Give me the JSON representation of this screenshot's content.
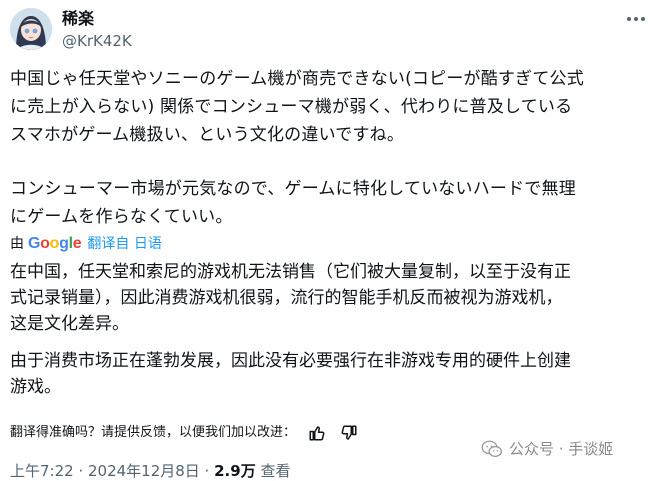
{
  "author": {
    "display_name": "稀楽",
    "handle": "@KrK42K"
  },
  "post": {
    "lines_p1": [
      "中国じゃ任天堂やソニーのゲーム機が商売できない(コピーが酷すぎて公式",
      "に売上が入らない) 関係でコンシューマ機が弱く、代わりに普及している",
      "スマホがゲーム機扱い、という文化の違いですね。"
    ],
    "lines_p2": [
      "コンシューマー市場が元気なので、ゲームに特化していないハードで無理",
      "にゲームを作らなくていい。"
    ]
  },
  "translation": {
    "by_label": "由",
    "provider": "Google",
    "link_label": "翻译自 日语",
    "lines_t1": [
      "在中国，任天堂和索尼的游戏机无法销售（它们被大量复制，以至于没有正",
      "式记录销量），因此消费游戏机很弱，流行的智能手机反而被视为游戏机，",
      "这是文化差异。"
    ],
    "lines_t2": [
      "由于消费市场正在蓬勃发展，因此没有必要强行在非游戏专用的硬件上创建",
      "游戏。"
    ],
    "feedback_prompt": "翻译得准确吗？请提供反馈，以便我们加以改进："
  },
  "meta": {
    "timestamp": "上午7:22 · 2024年12月8日 ·",
    "views_count": "2.9万",
    "views_label": "查看"
  },
  "watermark": {
    "text": "公众号 · 手谈姬"
  },
  "colors": {
    "link": "#1d9bf0",
    "secondary": "#536471",
    "text": "#0f1419"
  },
  "icons": [
    "more-icon",
    "thumbs-up-icon",
    "thumbs-down-icon",
    "wechat-icon",
    "google-logo"
  ]
}
